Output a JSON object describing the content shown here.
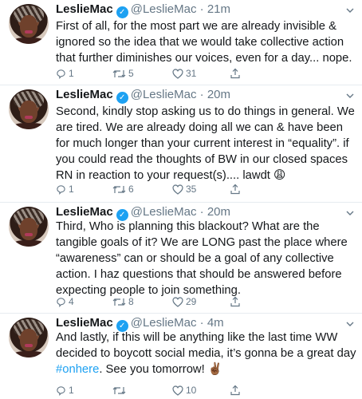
{
  "tweets": [
    {
      "name": "LeslieMac",
      "handle": "@LeslieMac",
      "sep": "·",
      "time": "21m",
      "text": "First of all, for the most part we are already invisible & ignored so the idea that we would take collective action that further diminishes our voices, even for a day... nope.",
      "replies": "1",
      "retweets": "5",
      "likes": "31"
    },
    {
      "name": "LeslieMac",
      "handle": "@LeslieMac",
      "sep": "·",
      "time": "20m",
      "text": "Second, kindly stop asking us to do things in general. We are tired. We are already doing all we can & have been for much longer than your current interest in “equality”. if you could read the thoughts of BW in our closed spaces RN in reaction to your request(s).... lawdt 😩",
      "replies": "1",
      "retweets": "6",
      "likes": "35"
    },
    {
      "name": "LeslieMac",
      "handle": "@LeslieMac",
      "sep": "·",
      "time": "20m",
      "text": "Third, Who is planning this blackout? What are the tangible goals of it? We are LONG past the place where “awareness” can or should be a goal of any collective action. I haz questions that should be answered before expecting people to join something.",
      "replies": "4",
      "retweets": "8",
      "likes": "29"
    },
    {
      "name": "LeslieMac",
      "handle": "@LeslieMac",
      "sep": "·",
      "time": "4m",
      "text_before": "And lastly, if this will be anything like the last time WW decided to boycott social media, it’s gonna be a great day ",
      "hashtag": "#onhere",
      "text_after": ". See you tomorrow! ✌🏾",
      "replies": "1",
      "retweets": "",
      "likes": "10"
    }
  ],
  "icons": {
    "verified": "verified-badge-icon",
    "reply": "reply-icon",
    "retweet": "retweet-icon",
    "like": "heart-icon",
    "share": "share-icon",
    "more": "chevron-down-icon"
  },
  "colors": {
    "text": "#14171a",
    "secondary": "#657786",
    "link": "#1da1f2",
    "divider": "#e6ecf0"
  }
}
